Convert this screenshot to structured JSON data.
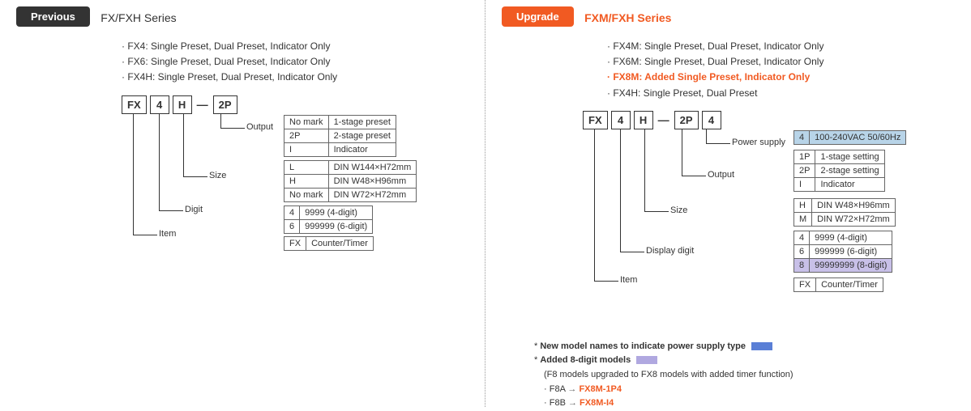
{
  "left": {
    "badge": "Previous",
    "series": "FX/FXH Series",
    "bullets": [
      "FX4:    Single Preset, Dual Preset, Indicator Only",
      "FX6:    Single Preset, Dual Preset, Indicator Only",
      "FX4H: Single Preset, Dual Preset, Indicator Only"
    ],
    "code": [
      "FX",
      "4",
      "H",
      "—",
      "2P"
    ],
    "labels": {
      "output": "Output",
      "size": "Size",
      "digit": "Digit",
      "item": "Item"
    },
    "tables": {
      "output": [
        [
          "No mark",
          "1-stage preset"
        ],
        [
          "2P",
          "2-stage preset"
        ],
        [
          "I",
          "Indicator"
        ]
      ],
      "size": [
        [
          "L",
          "DIN W144×H72mm"
        ],
        [
          "H",
          "DIN W48×H96mm"
        ],
        [
          "No mark",
          "DIN W72×H72mm"
        ]
      ],
      "digit": [
        [
          "4",
          "9999 (4-digit)"
        ],
        [
          "6",
          "999999 (6-digit)"
        ]
      ],
      "item": [
        [
          "FX",
          "Counter/Timer"
        ]
      ]
    }
  },
  "right": {
    "badge": "Upgrade",
    "series": "FXM/FXH Series",
    "bullets": [
      {
        "t": "FX4M:  Single Preset, Dual Preset, Indicator Only"
      },
      {
        "t": "FX6M:  Single Preset, Dual Preset, Indicator Only"
      },
      {
        "t": "FX8M: Added Single Preset, Indicator Only",
        "hl": true
      },
      {
        "t": "FX4H:   Single Preset, Dual Preset"
      }
    ],
    "code": [
      "FX",
      "4",
      "H",
      "—",
      "2P",
      "4"
    ],
    "labels": {
      "power": "Power supply",
      "output": "Output",
      "size": "Size",
      "digit": "Display digit",
      "item": "Item"
    },
    "tables": {
      "power": [
        [
          "4",
          "100-240VAC 50/60Hz"
        ]
      ],
      "output": [
        [
          "1P",
          "1-stage setting"
        ],
        [
          "2P",
          "2-stage setting"
        ],
        [
          "I",
          "Indicator"
        ]
      ],
      "size": [
        [
          "H",
          "DIN W48×H96mm"
        ],
        [
          "M",
          "DIN W72×H72mm"
        ]
      ],
      "digit": [
        [
          "4",
          "9999 (4-digit)"
        ],
        [
          "6",
          "999999 (6-digit)"
        ],
        [
          "8",
          "99999999 (8-digit)"
        ]
      ],
      "item": [
        [
          "FX",
          "Counter/Timer"
        ]
      ]
    },
    "notes": {
      "n1": "New model names to indicate power supply type",
      "n2": "Added 8-digit models",
      "n2sub": "(F8 models upgraded to FX8 models with added timer function)",
      "m1a": "F8A",
      "m1b": "FX8M-1P4",
      "m2a": "F8B",
      "m2b": "FX8M-I4",
      "arrow": "→"
    }
  }
}
